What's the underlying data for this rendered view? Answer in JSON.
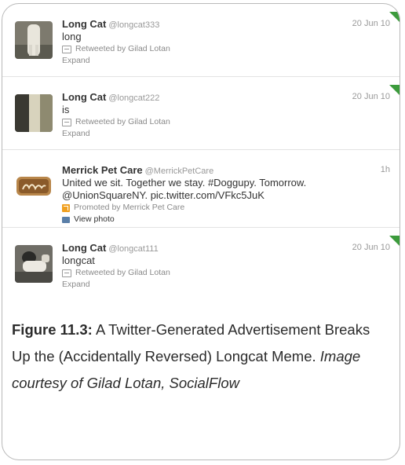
{
  "tweets": [
    {
      "name": "Long Cat",
      "handle": "@longcat333",
      "time": "20 Jun 10",
      "text": "long",
      "meta": "Retweeted by Gilad Lotan",
      "expand": "Expand",
      "avatar_icon": "longcat-avatar-icon"
    },
    {
      "name": "Long Cat",
      "handle": "@longcat222",
      "time": "20 Jun 10",
      "text": "is",
      "meta": "Retweeted by Gilad Lotan",
      "expand": "Expand",
      "avatar_icon": "longcat-avatar-icon"
    },
    {
      "name": "Merrick Pet Care",
      "handle": "@MerrickPetCare",
      "time": "1h",
      "text_line1": "United we sit. Together we stay. #Doggupy. Tomorrow.",
      "text_line2": "@UnionSquareNY. pic.twitter.com/VFkc5JuK",
      "meta": "Promoted by Merrick Pet Care",
      "view_photo": "View photo",
      "avatar_icon": "merrick-logo-icon"
    },
    {
      "name": "Long Cat",
      "handle": "@longcat111",
      "time": "20 Jun 10",
      "text": "longcat",
      "meta": "Retweeted by Gilad Lotan",
      "expand": "Expand",
      "avatar_icon": "longcat-avatar-icon"
    }
  ],
  "caption": {
    "label": "Figure 11.3:",
    "text": " A Twitter-Generated Advertisement Breaks Up the (Accidentally Reversed) Longcat Meme. ",
    "credit": "Image courtesy of Gilad Lotan, SocialFlow"
  },
  "colors": {
    "corner_marker": "#3c9b3c",
    "promoted_icon": "#f0a020",
    "frame_border": "#b9b9b9"
  }
}
